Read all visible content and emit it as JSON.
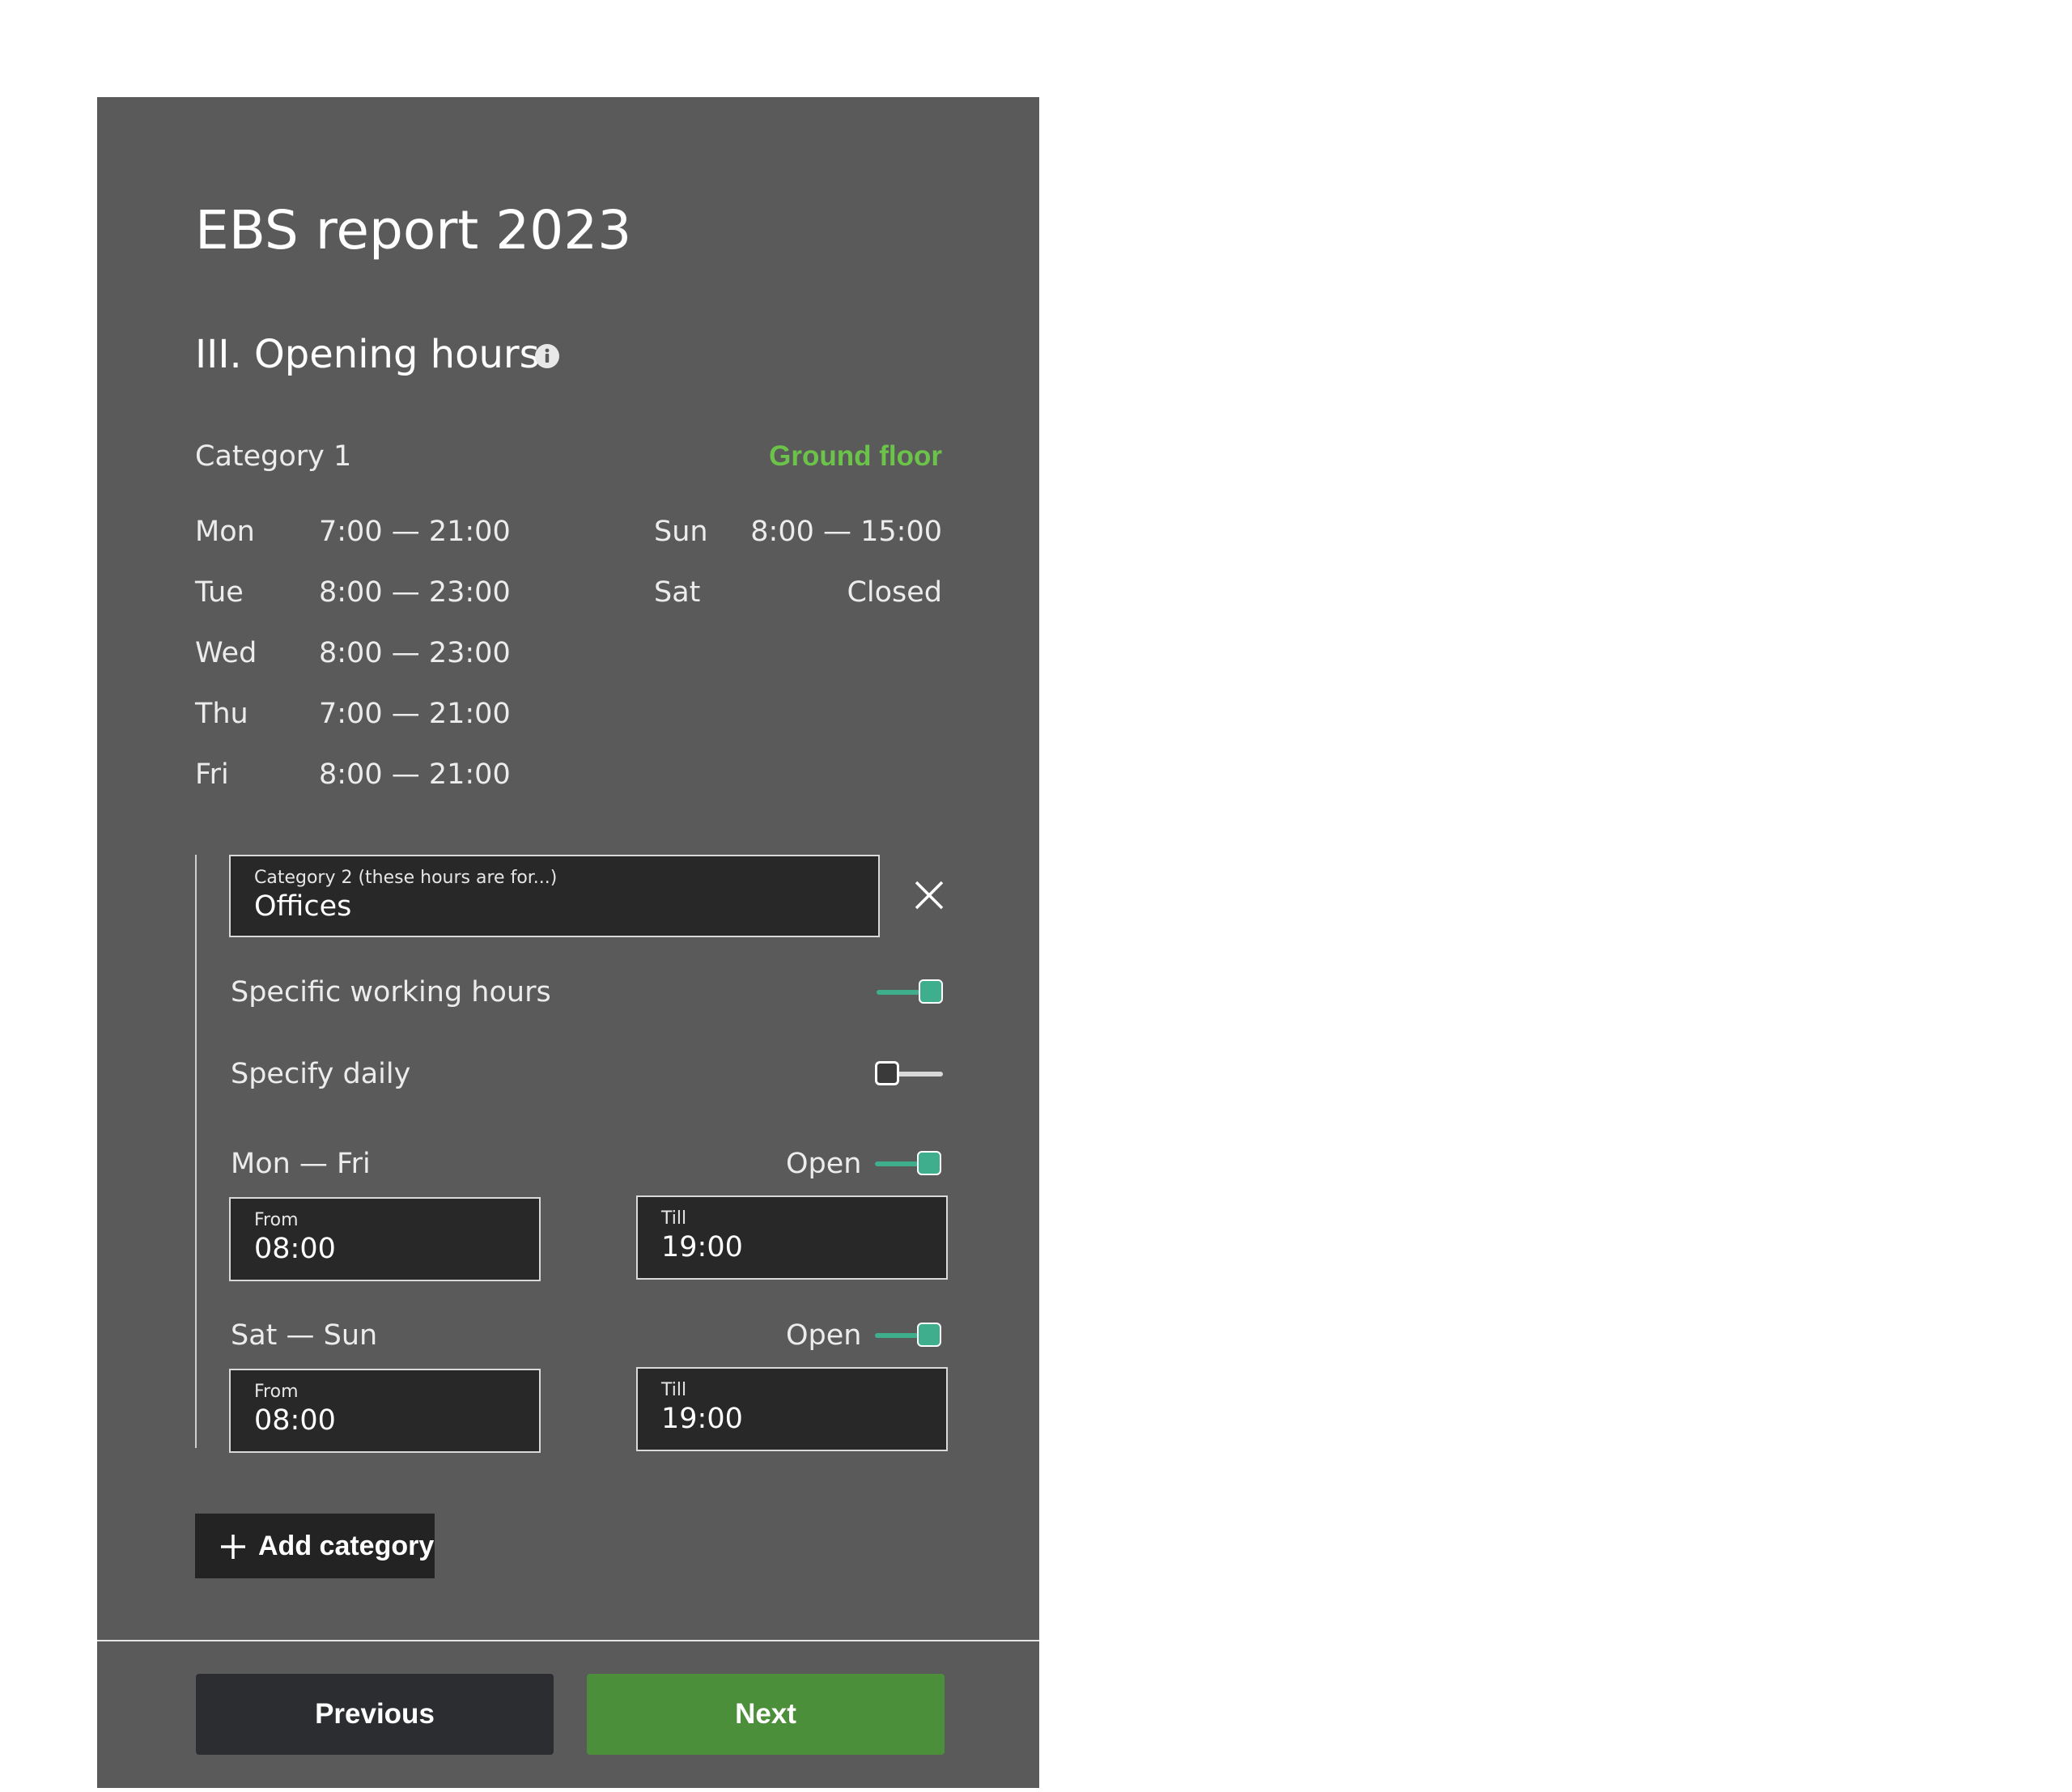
{
  "colors": {
    "panel_bg": "#5a5a5a",
    "accent_green": "#6cc34a",
    "toggle_on": "#3fae8c",
    "next_button": "#4c8f3a",
    "previous_button": "#2b2d30",
    "field_bg": "#282828"
  },
  "header": {
    "title": "EBS report 2023",
    "section": "III. Opening hours",
    "info_icon": "info-icon"
  },
  "category1": {
    "label": "Category 1",
    "location": "Ground floor",
    "days": [
      {
        "day": "Mon",
        "hours": "7:00 — 21:00"
      },
      {
        "day": "Tue",
        "hours": "8:00 — 23:00"
      },
      {
        "day": "Wed",
        "hours": "8:00 — 23:00"
      },
      {
        "day": "Thu",
        "hours": "7:00 — 21:00"
      },
      {
        "day": "Fri",
        "hours": "8:00 — 21:00"
      },
      {
        "day": "Sun",
        "hours": "8:00 — 15:00"
      },
      {
        "day": "Sat",
        "hours": "Closed"
      }
    ]
  },
  "category2": {
    "field_label": "Category 2 (these hours are for...)",
    "field_value": "Offices",
    "remove_icon": "close-icon",
    "specific_working_hours": {
      "label": "Specific working hours",
      "on": true
    },
    "specify_daily": {
      "label": "Specify daily",
      "on": false
    },
    "groups": [
      {
        "label": "Mon — Fri",
        "open_label": "Open",
        "open": true,
        "from_label": "From",
        "from_value": "08:00",
        "till_label": "Till",
        "till_value": "19:00"
      },
      {
        "label": "Sat — Sun",
        "open_label": "Open",
        "open": true,
        "from_label": "From",
        "from_value": "08:00",
        "till_label": "Till",
        "till_value": "19:00"
      }
    ]
  },
  "actions": {
    "add_category": "Add category",
    "add_icon": "plus-icon",
    "previous": "Previous",
    "next": "Next"
  }
}
